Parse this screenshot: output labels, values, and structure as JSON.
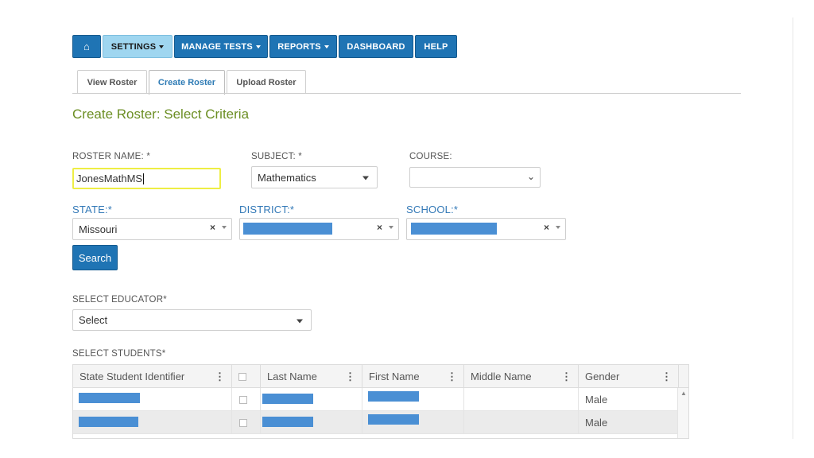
{
  "nav": {
    "home_icon": "home-icon",
    "items": [
      {
        "label": "SETTINGS",
        "dropdown": true,
        "active": true
      },
      {
        "label": "MANAGE TESTS",
        "dropdown": true
      },
      {
        "label": "REPORTS",
        "dropdown": true
      },
      {
        "label": "DASHBOARD"
      },
      {
        "label": "HELP"
      }
    ]
  },
  "tabs": [
    {
      "label": "View Roster"
    },
    {
      "label": "Create Roster",
      "active": true
    },
    {
      "label": "Upload Roster"
    }
  ],
  "page_title": "Create Roster: Select Criteria",
  "form": {
    "roster_name": {
      "label": "ROSTER NAME: *",
      "value": "JonesMathMS"
    },
    "subject": {
      "label": "SUBJECT: *",
      "value": "Mathematics"
    },
    "course": {
      "label": "COURSE:",
      "value": ""
    },
    "state": {
      "label": "STATE:*",
      "value": "Missouri"
    },
    "district": {
      "label": "DISTRICT:*"
    },
    "school": {
      "label": "SCHOOL:*"
    },
    "clear_glyph": "×",
    "search_label": "Search",
    "educator": {
      "label": "SELECT EDUCATOR*",
      "value": "Select"
    }
  },
  "students": {
    "label": "SELECT STUDENTS*",
    "columns": [
      "State Student Identifier",
      "",
      "Last Name",
      "First Name",
      "Middle Name",
      "Gender"
    ],
    "rows": [
      {
        "gender": "Male"
      },
      {
        "gender": "Male"
      }
    ]
  },
  "colors": {
    "nav_blue": "#1f74b4",
    "nav_active": "#9fd6f0",
    "title_green": "#6b8e23",
    "label_blue": "#3379b7",
    "highlight_yellow": "#eeee44",
    "redaction_blue": "#4a8fd4"
  }
}
